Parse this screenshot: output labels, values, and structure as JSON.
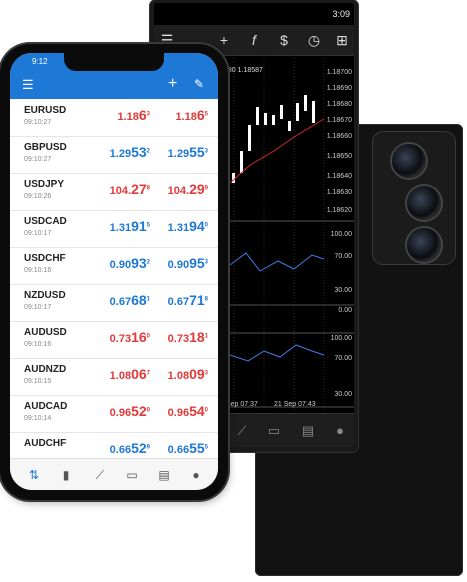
{
  "android": {
    "status_time": "3:09",
    "toolbar_icons": [
      "menu-icon",
      "crosshair-icon",
      "function-icon",
      "dollar-icon",
      "clock-icon",
      "add-icon"
    ],
    "price_ticks": [
      "1.18700",
      "1.18690",
      "1.18680",
      "1.18670",
      "1.18660",
      "1.18650",
      "1.18640",
      "1.18630",
      "1.18620"
    ],
    "top_label": "580 1.18587",
    "ind_ticks_1": [
      "100.00",
      "70.00",
      "30.00",
      "0.00"
    ],
    "ind_ticks_2": [
      "100.00",
      "70.00",
      "30.00"
    ],
    "x_labels": [
      "Sep 07:37",
      "21 Sep 07:43"
    ],
    "bottom_icons": [
      "chart-icon",
      "inbox-icon",
      "news-icon",
      "chat-icon"
    ]
  },
  "iphone": {
    "status_time": "9:12",
    "header_icons": [
      "menu-icon",
      "add-icon",
      "edit-icon"
    ],
    "quotes": [
      {
        "symbol": "EURUSD",
        "time": "09:10:27",
        "bid_pre": "1.18",
        "bid_big": "6",
        "bid_sup": "3",
        "ask_pre": "1.18",
        "ask_big": "6",
        "ask_sup": "5",
        "color": "red"
      },
      {
        "symbol": "GBPUSD",
        "time": "09:10:27",
        "bid_pre": "1.29",
        "bid_big": "53",
        "bid_sup": "2",
        "ask_pre": "1.29",
        "ask_big": "55",
        "ask_sup": "3",
        "color": "blue"
      },
      {
        "symbol": "USDJPY",
        "time": "09:10:26",
        "bid_pre": "104.",
        "bid_big": "27",
        "bid_sup": "8",
        "ask_pre": "104.",
        "ask_big": "29",
        "ask_sup": "9",
        "color": "red"
      },
      {
        "symbol": "USDCAD",
        "time": "09:10:17",
        "bid_pre": "1.31",
        "bid_big": "91",
        "bid_sup": "5",
        "ask_pre": "1.31",
        "ask_big": "94",
        "ask_sup": "0",
        "color": "blue"
      },
      {
        "symbol": "USDCHF",
        "time": "09:10:16",
        "bid_pre": "0.90",
        "bid_big": "93",
        "bid_sup": "2",
        "ask_pre": "0.90",
        "ask_big": "95",
        "ask_sup": "3",
        "color": "blue"
      },
      {
        "symbol": "NZDUSD",
        "time": "09:10:17",
        "bid_pre": "0.67",
        "bid_big": "68",
        "bid_sup": "1",
        "ask_pre": "0.67",
        "ask_big": "71",
        "ask_sup": "8",
        "color": "blue"
      },
      {
        "symbol": "AUDUSD",
        "time": "09:10:16",
        "bid_pre": "0.73",
        "bid_big": "16",
        "bid_sup": "0",
        "ask_pre": "0.73",
        "ask_big": "18",
        "ask_sup": "1",
        "color": "red"
      },
      {
        "symbol": "AUDNZD",
        "time": "09:10:15",
        "bid_pre": "1.08",
        "bid_big": "06",
        "bid_sup": "7",
        "ask_pre": "1.08",
        "ask_big": "09",
        "ask_sup": "3",
        "color": "red"
      },
      {
        "symbol": "AUDCAD",
        "time": "09:10:14",
        "bid_pre": "0.96",
        "bid_big": "52",
        "bid_sup": "0",
        "ask_pre": "0.96",
        "ask_big": "54",
        "ask_sup": "0",
        "color": "red"
      },
      {
        "symbol": "AUDCHF",
        "time": "",
        "bid_pre": "0.66",
        "bid_big": "52",
        "bid_sup": "9",
        "ask_pre": "0.66",
        "ask_big": "55",
        "ask_sup": "5",
        "color": "blue"
      }
    ],
    "tab_icons": [
      "quotes-icon",
      "chart-icon",
      "trade-icon",
      "history-icon",
      "news-icon",
      "chat-icon"
    ]
  },
  "colors": {
    "accent": "#1e78d6",
    "bid_red": "#e03a3a",
    "bid_blue": "#1e78d6",
    "chart_bg": "#000000"
  }
}
